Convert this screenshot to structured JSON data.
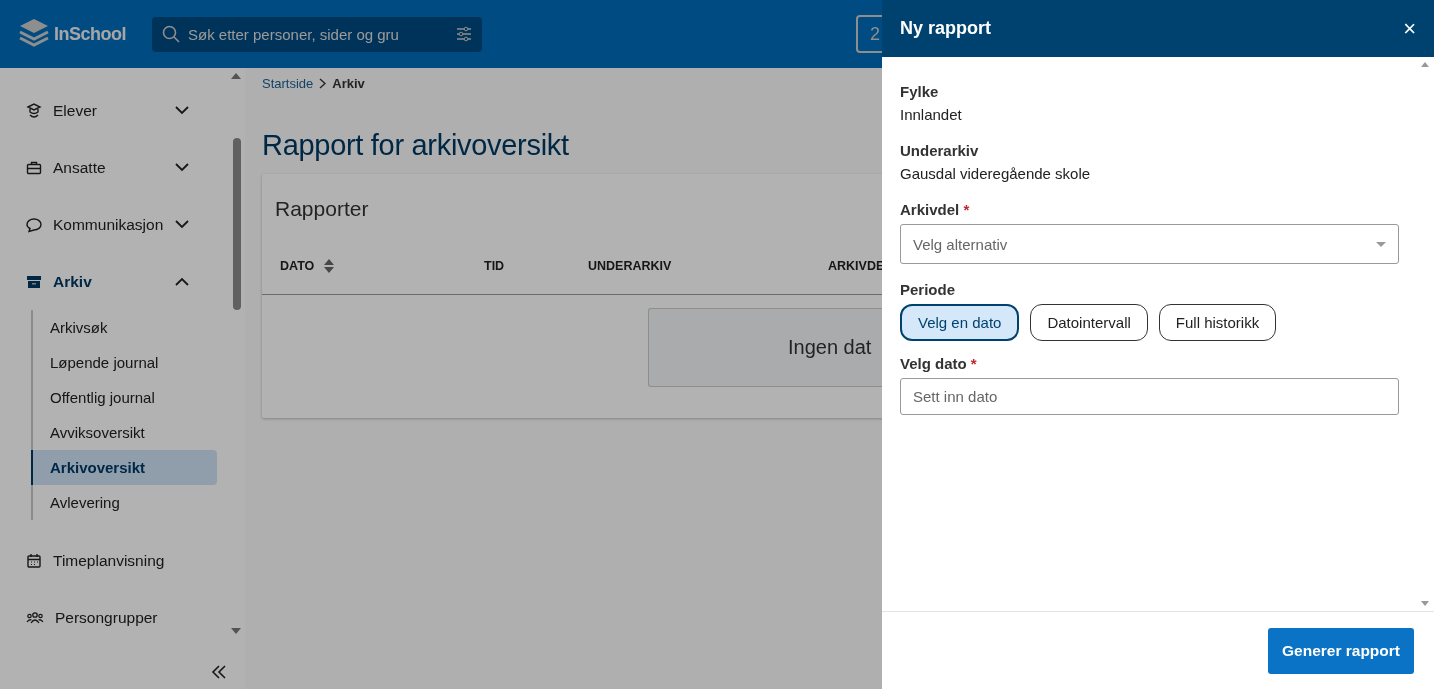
{
  "header": {
    "logo": "InSchool",
    "search": {
      "placeholder": "Søk etter personer, sider og gru"
    },
    "box_text": "2"
  },
  "sidebar": {
    "items": [
      {
        "label": "Elever",
        "kind": "group",
        "expanded": false,
        "selected": false
      },
      {
        "label": "Ansatte",
        "kind": "group",
        "expanded": false,
        "selected": false
      },
      {
        "label": "Kommunikasjon",
        "kind": "group",
        "expanded": false,
        "selected": false
      },
      {
        "label": "Arkiv",
        "kind": "group",
        "expanded": true,
        "selected": true,
        "children": [
          {
            "label": "Arkivsøk",
            "selected": false
          },
          {
            "label": "Løpende journal",
            "selected": false
          },
          {
            "label": "Offentlig journal",
            "selected": false
          },
          {
            "label": "Avviksoversikt",
            "selected": false
          },
          {
            "label": "Arkivoversikt",
            "selected": true
          },
          {
            "label": "Avlevering",
            "selected": false
          }
        ]
      },
      {
        "label": "Timeplanvisning",
        "kind": "link",
        "selected": false
      },
      {
        "label": "Persongrupper",
        "kind": "link",
        "selected": false
      }
    ]
  },
  "breadcrumb": [
    {
      "label": "Startside",
      "kind": "link"
    },
    {
      "label": "Arkiv",
      "kind": "current"
    }
  ],
  "page_title": "Rapport for arkivoversikt",
  "card": {
    "title": "Rapporter",
    "columns": [
      {
        "label": "DATO",
        "sortable": true
      },
      {
        "label": "TID",
        "sortable": false
      },
      {
        "label": "UNDERARKIV",
        "sortable": false
      },
      {
        "label": "ARKIVDE"
      }
    ],
    "empty_text": "Ingen dat"
  },
  "drawer": {
    "title": "Ny rapport",
    "close": "×",
    "info": [
      {
        "label": "Fylke",
        "value": "Innlandet"
      },
      {
        "label": "Underarkiv",
        "value": "Gausdal videregående skole"
      }
    ],
    "arkivdel": {
      "label": "Arkivdel",
      "required_mark": "*",
      "placeholder": "Velg alternativ"
    },
    "periode": {
      "label": "Periode",
      "options": [
        {
          "label": "Velg en dato",
          "selected": true
        },
        {
          "label": "Datointervall",
          "selected": false
        },
        {
          "label": "Full historikk",
          "selected": false
        }
      ]
    },
    "dato": {
      "label": "Velg dato",
      "required_mark": "*",
      "placeholder": "Sett inn dato"
    },
    "submit": "Generer rapport"
  }
}
